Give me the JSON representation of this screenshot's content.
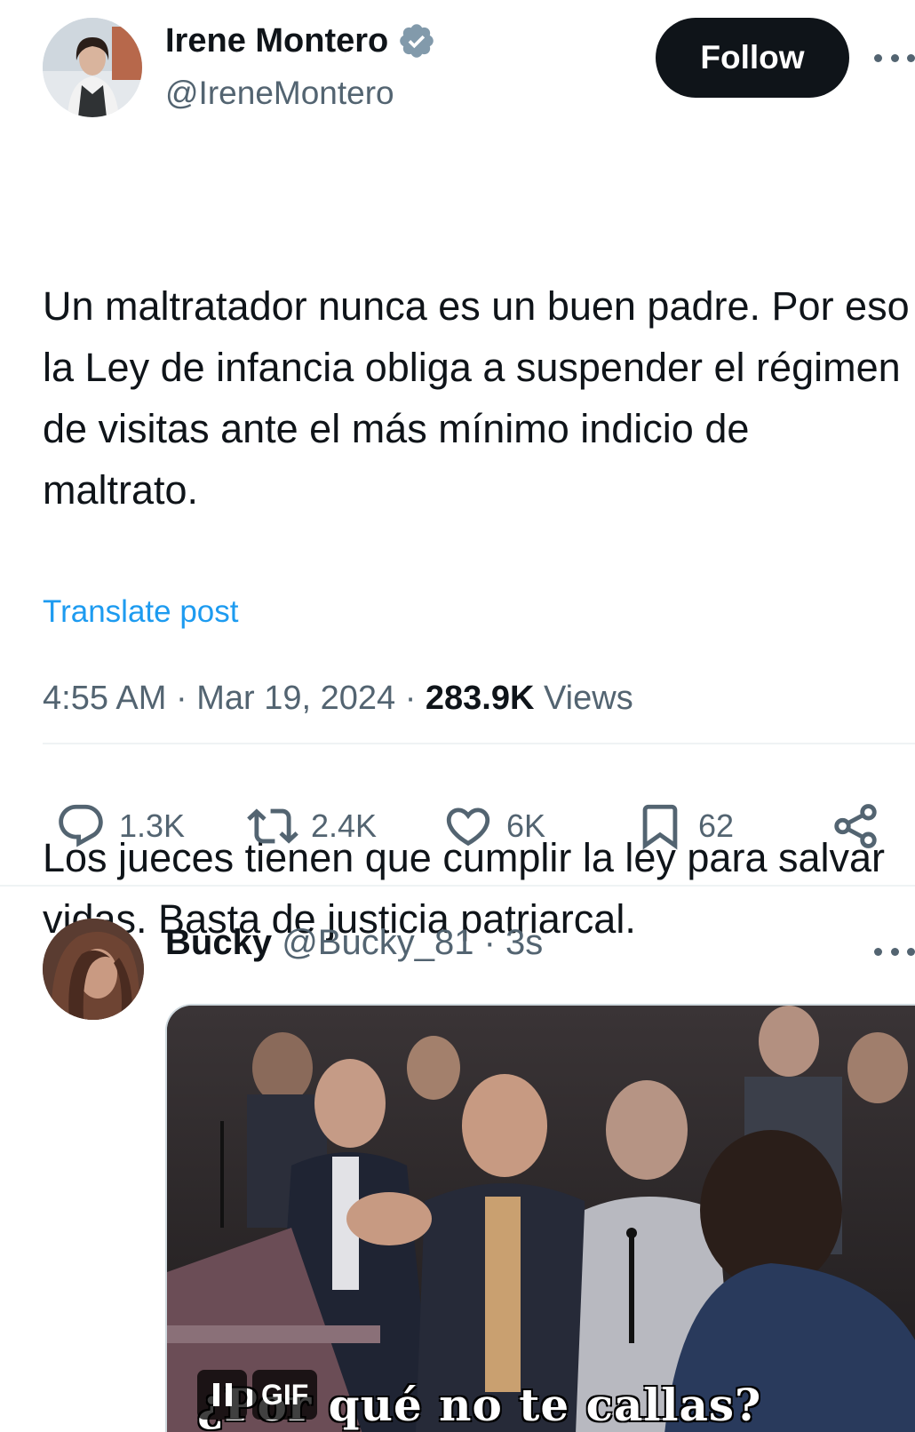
{
  "tweet": {
    "author_name": "Irene Montero",
    "author_handle": "@IreneMontero",
    "follow_label": "Follow",
    "paragraphs": [
      "Un maltratador nunca es un buen padre. Por eso la Ley de infancia obliga a suspender el régimen de visitas ante el más mínimo indicio de maltrato.",
      "Los jueces tienen que cumplir la ley para salvar vidas. Basta de justicia patriarcal."
    ],
    "translate_label": "Translate post",
    "time": "4:55 AM",
    "date": "Mar 19, 2024",
    "views_count": "283.9K",
    "views_label": "Views",
    "separator": "·"
  },
  "actions": {
    "replies": "1.3K",
    "reposts": "2.4K",
    "likes": "6K",
    "bookmarks": "62"
  },
  "reply": {
    "author_name": "Bucky",
    "author_handle": "@Bucky_81",
    "time": "3s",
    "separator": "·",
    "gif_badge": "GIF",
    "gif_caption": "¿Por qué no te callas?"
  },
  "colors": {
    "text_primary": "#0f1419",
    "text_secondary": "#536471",
    "link": "#1d9bf0",
    "verified": "#829aab",
    "follow_bg": "#0f1419"
  },
  "icons": {
    "verified": "verified-badge-icon",
    "more": "more-horizontal-icon",
    "reply": "reply-bubble-icon",
    "repost": "repost-icon",
    "like": "heart-icon",
    "bookmark": "bookmark-icon",
    "share": "share-icon",
    "pause": "pause-icon"
  }
}
